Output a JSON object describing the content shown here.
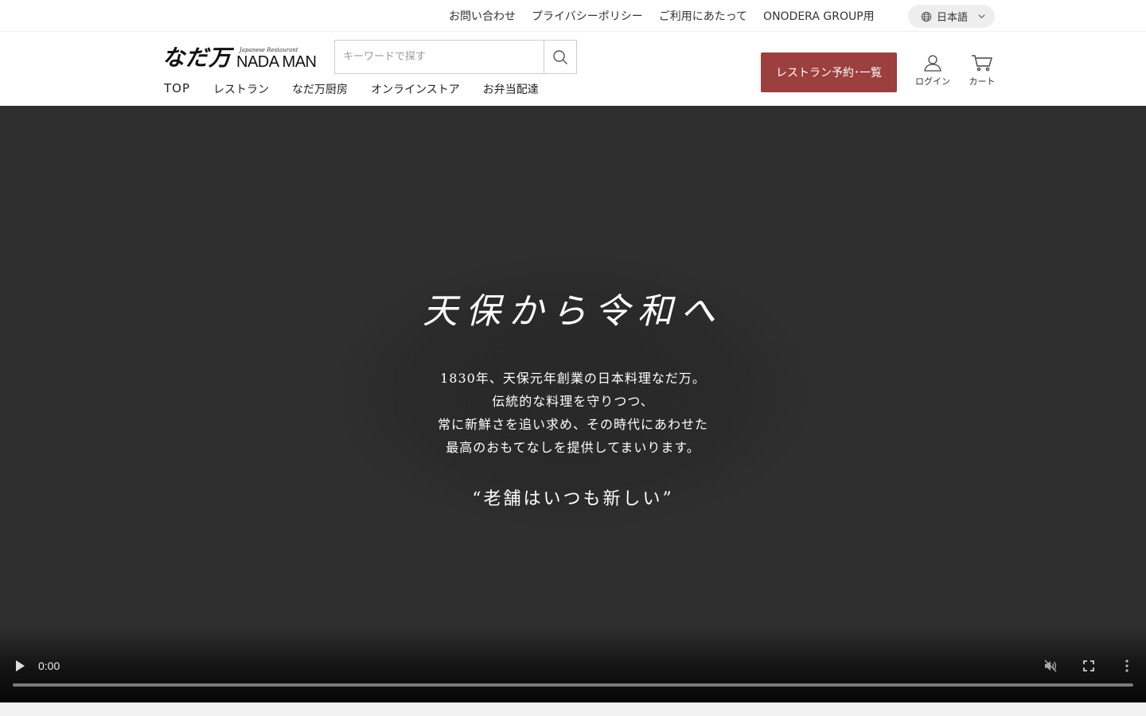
{
  "utility": {
    "links": [
      {
        "label": "お問い合わせ"
      },
      {
        "label": "プライバシーポリシー"
      },
      {
        "label": "ご利用にあたって"
      },
      {
        "label": "ONODERA GROUP用"
      }
    ],
    "language": "日本語"
  },
  "header": {
    "logo_kanji": "なだ万",
    "logo_sub": "Japanese Restaurant",
    "logo_en": "NADA MAN",
    "search_placeholder": "キーワードで探す",
    "nav": [
      {
        "label": "TOP"
      },
      {
        "label": "レストラン"
      },
      {
        "label": "なだ万厨房"
      },
      {
        "label": "オンラインストア"
      },
      {
        "label": "お弁当配達"
      }
    ],
    "reserve_label": "レストラン予約･一覧",
    "login_label": "ログイン",
    "cart_label": "カート"
  },
  "hero": {
    "title": "天保から令和へ",
    "body": [
      "1830年、天保元年創業の日本料理なだ万。",
      "伝統的な料理を守りつつ、",
      "常に新鮮さを追い求め、その時代にあわせた",
      "最高のおもてなしを提供してまいります。"
    ],
    "quote": "“老舗はいつも新しい”"
  },
  "video": {
    "time": "0:00",
    "progress": 0
  },
  "colors": {
    "accent": "#9c3f3f",
    "hero_bg": "#2f2f2f"
  },
  "icons": [
    "globe-icon",
    "chevron-down-icon",
    "search-icon",
    "user-icon",
    "cart-icon",
    "play-icon",
    "mute-icon",
    "fullscreen-icon",
    "more-vertical-icon"
  ]
}
